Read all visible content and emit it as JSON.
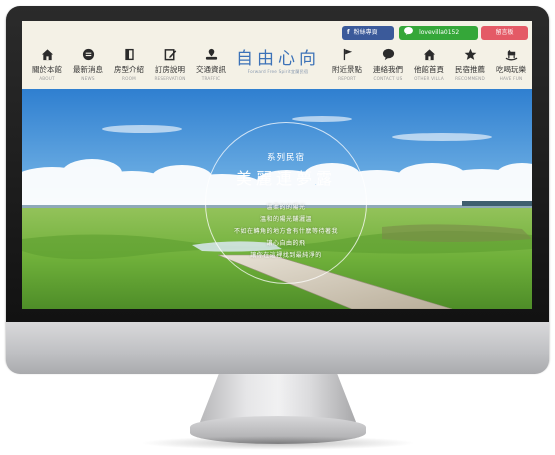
{
  "header": {
    "social": {
      "facebook": {
        "icon": "facebook-icon",
        "label": "粉絲專頁"
      },
      "line": {
        "icon": "line-icon",
        "label": "lovevilla0152"
      },
      "guestbook": {
        "label": "留言板"
      }
    },
    "logo": {
      "title": "自由心向",
      "tagline": "Forward Free Spirit宜蘭民宿"
    },
    "nav_left": [
      {
        "icon": "house-icon",
        "zh": "關於本館",
        "en": "ABOUT"
      },
      {
        "icon": "news-icon",
        "zh": "最新消息",
        "en": "NEWS"
      },
      {
        "icon": "door-icon",
        "zh": "房型介紹",
        "en": "ROOM"
      },
      {
        "icon": "pencil-icon",
        "zh": "訂房說明",
        "en": "RESERVATION"
      },
      {
        "icon": "car-icon",
        "zh": "交通資訊",
        "en": "TRAFFIC"
      }
    ],
    "nav_right": [
      {
        "icon": "flag-icon",
        "zh": "附近景點",
        "en": "REPORT"
      },
      {
        "icon": "chat-icon",
        "zh": "連絡我們",
        "en": "CONTACT US"
      },
      {
        "icon": "house-icon",
        "zh": "他館首頁",
        "en": "OTHER VILLA"
      },
      {
        "icon": "star-icon",
        "zh": "民宿推薦",
        "en": "RECOMMEND"
      },
      {
        "icon": "rocking-horse-icon",
        "zh": "吃喝玩樂",
        "en": "HAVE FUN"
      }
    ]
  },
  "hero": {
    "subtitle": "系列民宿",
    "title": "美麗連夢露",
    "lines": [
      "溫柔的的陽光",
      "溫和的陽光鋪灑溫",
      "不如在轉角的地方會有什麼等待著我",
      "讓心自由的飛",
      "讓你在這裡找到最純淨的"
    ],
    "colors": {
      "sky_top": "#2f7fd0",
      "grass": "#6fb03a"
    }
  }
}
